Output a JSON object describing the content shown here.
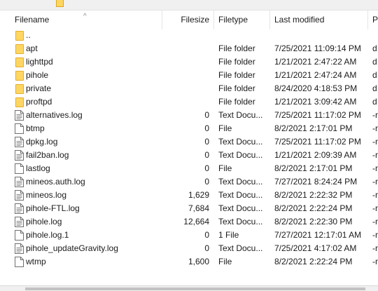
{
  "header": {
    "columns": [
      {
        "key": "filename",
        "label": "Filename"
      },
      {
        "key": "filesize",
        "label": "Filesize"
      },
      {
        "key": "filetype",
        "label": "Filetype"
      },
      {
        "key": "modified",
        "label": "Last modified"
      },
      {
        "key": "perm",
        "label": "P"
      }
    ],
    "sort_indicator": "^"
  },
  "files": [
    {
      "name": "..",
      "size": "",
      "type": "",
      "modified": "",
      "perm": "",
      "icon": "folder-icon"
    },
    {
      "name": "apt",
      "size": "",
      "type": "File folder",
      "modified": "7/25/2021 11:09:14 PM",
      "perm": "d",
      "icon": "folder-icon"
    },
    {
      "name": "lighttpd",
      "size": "",
      "type": "File folder",
      "modified": "1/21/2021 2:47:22 AM",
      "perm": "d",
      "icon": "folder-icon"
    },
    {
      "name": "pihole",
      "size": "",
      "type": "File folder",
      "modified": "1/21/2021 2:47:24 AM",
      "perm": "d",
      "icon": "folder-icon"
    },
    {
      "name": "private",
      "size": "",
      "type": "File folder",
      "modified": "8/24/2020 4:18:53 PM",
      "perm": "d",
      "icon": "folder-icon"
    },
    {
      "name": "proftpd",
      "size": "",
      "type": "File folder",
      "modified": "1/21/2021 3:09:42 AM",
      "perm": "d",
      "icon": "folder-icon"
    },
    {
      "name": "alternatives.log",
      "size": "0",
      "type": "Text Docu...",
      "modified": "7/25/2021 11:17:02 PM",
      "perm": "-r",
      "icon": "text-document-icon"
    },
    {
      "name": "btmp",
      "size": "0",
      "type": "File",
      "modified": "8/2/2021 2:17:01 PM",
      "perm": "-r",
      "icon": "file-icon"
    },
    {
      "name": "dpkg.log",
      "size": "0",
      "type": "Text Docu...",
      "modified": "7/25/2021 11:17:02 PM",
      "perm": "-r",
      "icon": "text-document-icon"
    },
    {
      "name": "fail2ban.log",
      "size": "0",
      "type": "Text Docu...",
      "modified": "1/21/2021 2:09:39 AM",
      "perm": "-r",
      "icon": "text-document-icon"
    },
    {
      "name": "lastlog",
      "size": "0",
      "type": "File",
      "modified": "8/2/2021 2:17:01 PM",
      "perm": "-r",
      "icon": "file-icon"
    },
    {
      "name": "mineos.auth.log",
      "size": "0",
      "type": "Text Docu...",
      "modified": "7/27/2021 8:24:24 PM",
      "perm": "-r",
      "icon": "text-document-icon"
    },
    {
      "name": "mineos.log",
      "size": "1,629",
      "type": "Text Docu...",
      "modified": "8/2/2021 2:22:32 PM",
      "perm": "-r",
      "icon": "text-document-icon"
    },
    {
      "name": "pihole-FTL.log",
      "size": "7,684",
      "type": "Text Docu...",
      "modified": "8/2/2021 2:22:24 PM",
      "perm": "-r",
      "icon": "text-document-icon"
    },
    {
      "name": "pihole.log",
      "size": "12,664",
      "type": "Text Docu...",
      "modified": "8/2/2021 2:22:30 PM",
      "perm": "-r",
      "icon": "text-document-icon"
    },
    {
      "name": "pihole.log.1",
      "size": "0",
      "type": "1 File",
      "modified": "7/27/2021 12:17:01 AM",
      "perm": "-r",
      "icon": "file-icon"
    },
    {
      "name": "pihole_updateGravity.log",
      "size": "0",
      "type": "Text Docu...",
      "modified": "7/25/2021 4:17:02 AM",
      "perm": "-r",
      "icon": "text-document-icon"
    },
    {
      "name": "wtmp",
      "size": "1,600",
      "type": "File",
      "modified": "8/2/2021 2:22:24 PM",
      "perm": "-r",
      "icon": "file-icon"
    }
  ],
  "colors": {
    "folder": "#ffd664",
    "folder_border": "#e0ae2a",
    "header_divider": "#e5e5e5"
  }
}
